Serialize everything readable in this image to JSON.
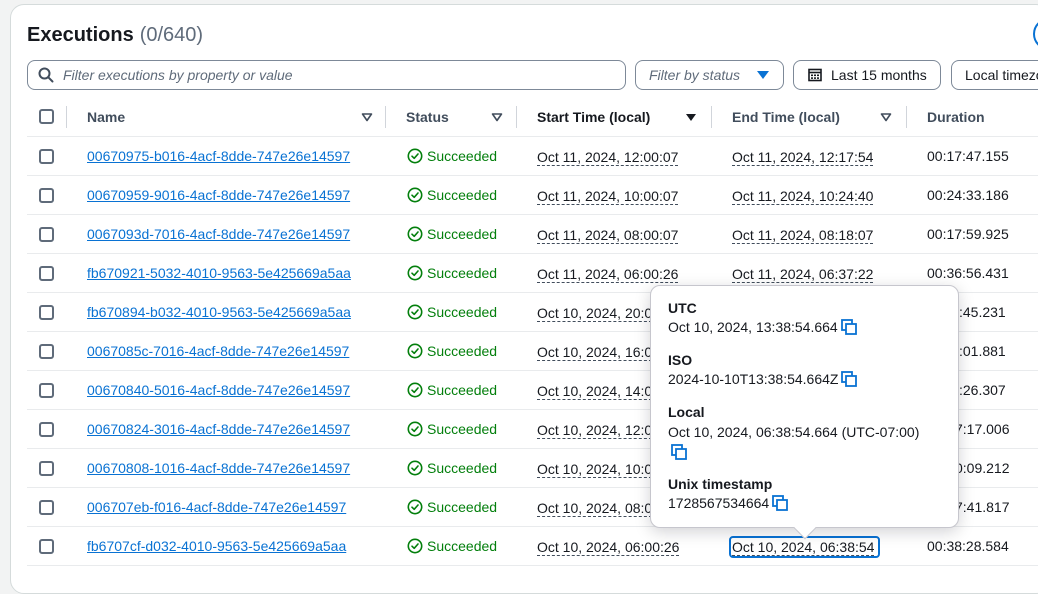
{
  "header": {
    "title": "Executions",
    "count": "(0/640)"
  },
  "toolbar": {
    "search_placeholder": "Filter executions by property or value",
    "status_filter_label": "Filter by status",
    "range_label": "Last 15 months",
    "timezone_label": "Local timezone"
  },
  "columns": {
    "name": "Name",
    "status": "Status",
    "start": "Start Time (local)",
    "end": "End Time (local)",
    "duration": "Duration"
  },
  "rows": [
    {
      "name": "00670975-b016-4acf-8dde-747e26e14597",
      "status": "Succeeded",
      "start": "Oct 11, 2024, 12:00:07",
      "end": "Oct 11, 2024, 12:17:54",
      "duration": "00:17:47.155"
    },
    {
      "name": "00670959-9016-4acf-8dde-747e26e14597",
      "status": "Succeeded",
      "start": "Oct 11, 2024, 10:00:07",
      "end": "Oct 11, 2024, 10:24:40",
      "duration": "00:24:33.186"
    },
    {
      "name": "0067093d-7016-4acf-8dde-747e26e14597",
      "status": "Succeeded",
      "start": "Oct 11, 2024, 08:00:07",
      "end": "Oct 11, 2024, 08:18:07",
      "duration": "00:17:59.925"
    },
    {
      "name": "fb670921-5032-4010-9563-5e425669a5aa",
      "status": "Succeeded",
      "start": "Oct 11, 2024, 06:00:26",
      "end": "Oct 11, 2024, 06:37:22",
      "duration": "00:36:56.431"
    },
    {
      "name": "fb670894-b032-4010-9563-5e425669a5aa",
      "status": "Succeeded",
      "start": "Oct 10, 2024, 20:0",
      "end": "",
      "duration": ":45.231"
    },
    {
      "name": "0067085c-7016-4acf-8dde-747e26e14597",
      "status": "Succeeded",
      "start": "Oct 10, 2024, 16:0",
      "end": "",
      "duration": ":01.881"
    },
    {
      "name": "00670840-5016-4acf-8dde-747e26e14597",
      "status": "Succeeded",
      "start": "Oct 10, 2024, 14:0",
      "end": "",
      "duration": ":26.307"
    },
    {
      "name": "00670824-3016-4acf-8dde-747e26e14597",
      "status": "Succeeded",
      "start": "Oct 10, 2024, 12:0",
      "end": "",
      "duration": "7:17.006"
    },
    {
      "name": "00670808-1016-4acf-8dde-747e26e14597",
      "status": "Succeeded",
      "start": "Oct 10, 2024, 10:0",
      "end": "",
      "duration": "0:09.212"
    },
    {
      "name": "006707eb-f016-4acf-8dde-747e26e14597",
      "status": "Succeeded",
      "start": "Oct 10, 2024, 08:0",
      "end": "",
      "duration": "7:41.817"
    },
    {
      "name": "fb6707cf-d032-4010-9563-5e425669a5aa",
      "status": "Succeeded",
      "start": "Oct 10, 2024, 06:00:26",
      "end": "Oct 10, 2024, 06:38:54",
      "duration": "00:38:28.584"
    }
  ],
  "popover": {
    "utc_label": "UTC",
    "utc_value": "Oct 10, 2024, 13:38:54.664",
    "iso_label": "ISO",
    "iso_value": "2024-10-10T13:38:54.664Z",
    "local_label": "Local",
    "local_value": "Oct 10, 2024, 06:38:54.664 (UTC-07:00)",
    "unix_label": "Unix timestamp",
    "unix_value": "1728567534664"
  },
  "icons": {
    "search": "search-icon",
    "calendar": "calendar-icon",
    "sort": "caret-down-icon",
    "status": "check-circle-icon",
    "copy": "copy-icon"
  },
  "colors": {
    "link": "#0972d3",
    "success": "#037f0c",
    "text": "#16191f",
    "muted": "#5f6b7a"
  }
}
